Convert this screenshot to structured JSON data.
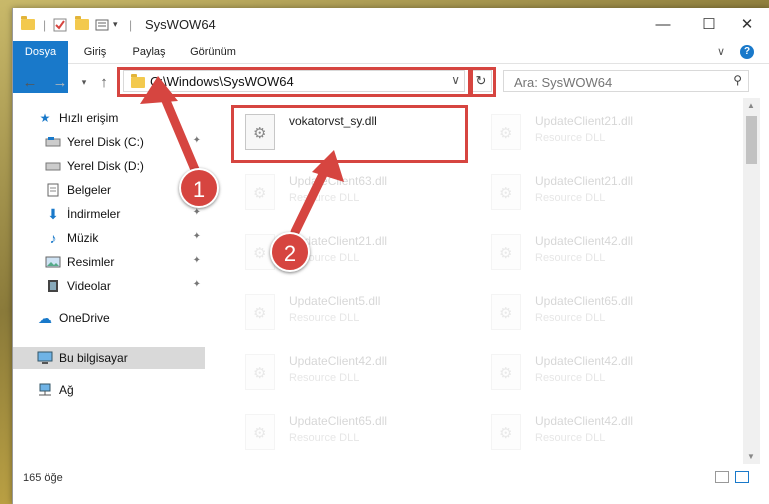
{
  "window": {
    "title": "SysWOW64"
  },
  "window_controls": {
    "minimize": "—",
    "maximize": "☐",
    "close": "✕"
  },
  "ribbon": {
    "tabs": [
      "Dosya",
      "Giriş",
      "Paylaş",
      "Görünüm"
    ],
    "collapse": "∨",
    "help": "?"
  },
  "address": {
    "path": "C:\\Windows\\SysWOW64",
    "search_placeholder": "Ara: SysWOW64"
  },
  "nav": {
    "quick_access": "Hızlı erişim",
    "items": [
      "Yerel Disk (C:)",
      "Yerel Disk (D:)",
      "Belgeler",
      "İndirmeler",
      "Müzik",
      "Resimler",
      "Videolar"
    ],
    "onedrive": "OneDrive",
    "this_pc": "Bu bilgisayar",
    "network": "Ağ"
  },
  "files": [
    {
      "name": "vokatorvst_sy.dll",
      "type": ""
    },
    {
      "name": "UpdateClient21.dll",
      "type": "Resource DLL"
    },
    {
      "name": "UpdateClient63.dll",
      "type": "Resource DLL"
    },
    {
      "name": "UpdateClient21.dll",
      "type": "Resource DLL"
    },
    {
      "name": "UpdateClient21.dll",
      "type": "Resource DLL"
    },
    {
      "name": "UpdateClient42.dll",
      "type": "Resource DLL"
    },
    {
      "name": "UpdateClient5.dll",
      "type": "Resource DLL"
    },
    {
      "name": "UpdateClient65.dll",
      "type": "Resource DLL"
    },
    {
      "name": "UpdateClient42.dll",
      "type": "Resource DLL"
    },
    {
      "name": "UpdateClient42.dll",
      "type": "Resource DLL"
    },
    {
      "name": "UpdateClient65.dll",
      "type": "Resource DLL"
    },
    {
      "name": "UpdateClient42.dll",
      "type": "Resource DLL"
    }
  ],
  "status": {
    "count": "165 öğe"
  },
  "annotations": {
    "step1": "1",
    "step2": "2",
    "color": "#d64540"
  }
}
